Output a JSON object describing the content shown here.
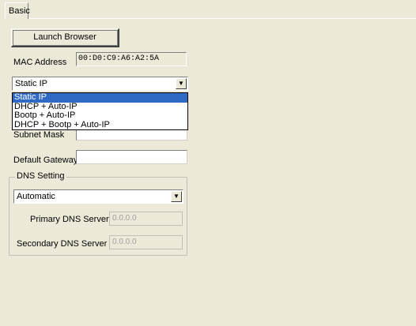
{
  "tabs": [
    {
      "label": "Basic"
    }
  ],
  "launch_button": {
    "label": "Launch Browser"
  },
  "mac": {
    "label": "MAC Address",
    "value": "00:D0:C9:A6:A2:5A"
  },
  "ip_mode": {
    "selected": "Static IP",
    "options": [
      "Static IP",
      "DHCP + Auto-IP",
      "Bootp + Auto-IP",
      "DHCP + Bootp + Auto-IP"
    ]
  },
  "subnet": {
    "label": "Subnet Mask",
    "value": ""
  },
  "gateway": {
    "label": "Default Gateway",
    "value": ""
  },
  "dns": {
    "group_title": "DNS Setting",
    "mode": "Automatic",
    "primary_label": "Primary DNS Server",
    "primary_value": "0.0.0.0",
    "secondary_label": "Secondary DNS Server",
    "secondary_value": "0.0.0.0"
  }
}
